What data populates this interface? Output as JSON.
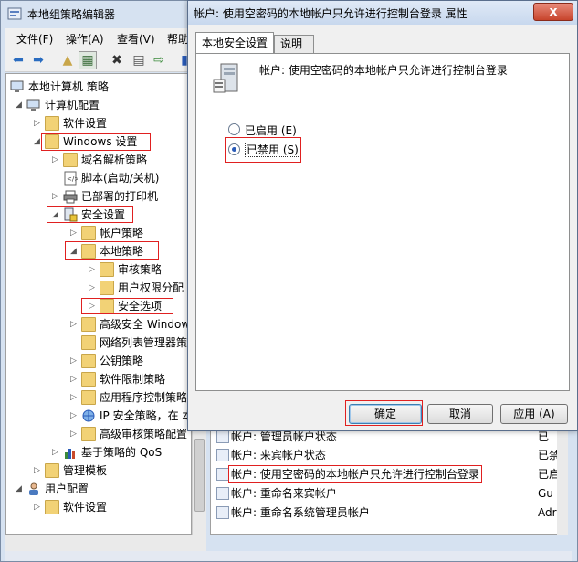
{
  "window": {
    "title": "本地组策略编辑器",
    "menu": [
      "文件(F)",
      "操作(A)",
      "查看(V)",
      "帮助"
    ]
  },
  "tree": {
    "items": [
      {
        "label": "本地计算机 策略"
      },
      {
        "label": "计算机配置"
      },
      {
        "label": "软件设置"
      },
      {
        "label": "Windows 设置"
      },
      {
        "label": "域名解析策略"
      },
      {
        "label": "脚本(启动/关机)"
      },
      {
        "label": "已部署的打印机"
      },
      {
        "label": "安全设置"
      },
      {
        "label": "帐户策略"
      },
      {
        "label": "本地策略"
      },
      {
        "label": "审核策略"
      },
      {
        "label": "用户权限分配"
      },
      {
        "label": "安全选项"
      },
      {
        "label": "高级安全 Window"
      },
      {
        "label": "网络列表管理器策"
      },
      {
        "label": "公钥策略"
      },
      {
        "label": "软件限制策略"
      },
      {
        "label": "应用程序控制策略"
      },
      {
        "label": "IP 安全策略，在 本"
      },
      {
        "label": "高级审核策略配置"
      },
      {
        "label": "基于策略的 QoS"
      },
      {
        "label": "管理模板"
      },
      {
        "label": "用户配置"
      },
      {
        "label": "软件设置"
      }
    ]
  },
  "list": {
    "rows": [
      {
        "name": "帐户: 管理员帐户状态",
        "value": "已"
      },
      {
        "name": "帐户: 来宾帐户状态",
        "value": "已禁"
      },
      {
        "name": "帐户: 使用空密码的本地帐户只允许进行控制台登录",
        "value": "已启"
      },
      {
        "name": "帐户: 重命名来宾帐户",
        "value": "Gu"
      },
      {
        "name": "帐户: 重命名系统管理员帐户",
        "value": "Adr"
      }
    ]
  },
  "dialog": {
    "title": "帐户: 使用空密码的本地帐户只允许进行控制台登录 属性",
    "close": "x",
    "tabs": [
      "本地安全设置",
      "说明"
    ],
    "policy_name": "帐户: 使用空密码的本地帐户只允许进行控制台登录",
    "options": [
      {
        "label": "已启用 (E)",
        "selected": false
      },
      {
        "label": "已禁用 (S)",
        "selected": true
      }
    ],
    "buttons": {
      "ok": "确定",
      "cancel": "取消",
      "apply": "应用 (A)"
    }
  }
}
